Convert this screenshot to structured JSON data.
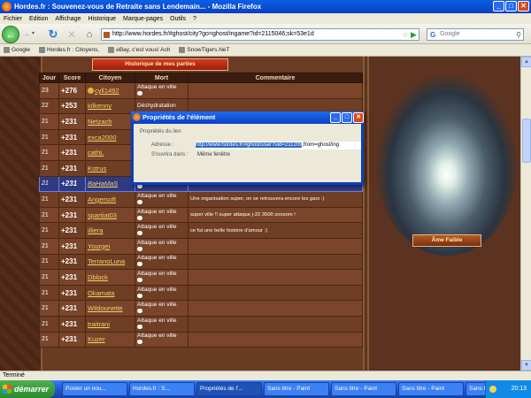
{
  "window": {
    "title": "Hordes.fr : Souvenez-vous de Retraite sans Lendemain... - Mozilla Firefox",
    "min": "_",
    "max": "□",
    "close": "✕"
  },
  "menu": [
    "Fichier",
    "Edition",
    "Affichage",
    "Historique",
    "Marque-pages",
    "Outils",
    "?"
  ],
  "nav": {
    "url": "http://www.hordes.fr/#ghost/city?go=ghost/ingame?id=2115046;sk=53e1d",
    "search_placeholder": "Google",
    "icons": [
      "back-arrow-icon",
      "forward-arrow-icon",
      "reload-icon",
      "stop-icon",
      "home-icon",
      "star-icon",
      "go-icon",
      "magnifier-icon"
    ]
  },
  "bookmarks": [
    "Google",
    "Hordes.fr : Citoyens,",
    "eBay, c'est vous! Ach",
    "SnowTigers.NeT"
  ],
  "page": {
    "history_title": "Historique de mes parties",
    "columns": [
      "Jour",
      "Score",
      "Citoyen",
      "Mort",
      "Commentaire"
    ],
    "rows": [
      {
        "day": "23",
        "score": "+276",
        "citizen": "cyll1492",
        "death": "Attaque en ville",
        "comment": ""
      },
      {
        "day": "22",
        "score": "+253",
        "citizen": "kilkenny",
        "death": "Déshydratation",
        "comment": ""
      },
      {
        "day": "21",
        "score": "+231",
        "citizen": "Netzach",
        "death": "",
        "comment": ""
      },
      {
        "day": "21",
        "score": "+231",
        "citizen": "exca2000",
        "death": "",
        "comment": ""
      },
      {
        "day": "21",
        "score": "+231",
        "citizen": "cathL",
        "death": "",
        "comment": ""
      },
      {
        "day": "21",
        "score": "+231",
        "citizen": "Kstrus",
        "death": "",
        "comment": ""
      },
      {
        "day": "21",
        "score": "+231",
        "citizen": "BaHaMaS",
        "death": "Attaque en ville",
        "comment": "",
        "highlight": true
      },
      {
        "day": "21",
        "score": "+231",
        "citizen": "Angersoft",
        "death": "Attaque en ville",
        "comment": "Une organisation super, on se retrouvera encore les gars :)"
      },
      {
        "day": "21",
        "score": "+231",
        "citizen": "spartiat03",
        "death": "Attaque en ville",
        "comment": "super ville !! super attaque j-22 3500 zoozom !"
      },
      {
        "day": "21",
        "score": "+231",
        "citizen": "illiera",
        "death": "Attaque en ville",
        "comment": "ce fut une belle histoire d'amour :)"
      },
      {
        "day": "21",
        "score": "+231",
        "citizen": "Yourgei",
        "death": "Attaque en ville",
        "comment": ""
      },
      {
        "day": "21",
        "score": "+231",
        "citizen": "TerranoLuna",
        "death": "Attaque en ville",
        "comment": ""
      },
      {
        "day": "21",
        "score": "+231",
        "citizen": "Dblock",
        "death": "Attaque en ville",
        "comment": ""
      },
      {
        "day": "21",
        "score": "+231",
        "citizen": "Okamata",
        "death": "Attaque en ville",
        "comment": ""
      },
      {
        "day": "21",
        "score": "+231",
        "citizen": "Wildounette",
        "death": "Attaque en ville",
        "comment": ""
      },
      {
        "day": "21",
        "score": "+231",
        "citizen": "traitrani",
        "death": "Attaque en ville",
        "comment": ""
      },
      {
        "day": "21",
        "score": "+231",
        "citizen": "Kuzer",
        "death": "Attaque en ville",
        "comment": ""
      }
    ],
    "soul_label": "Âme Faible"
  },
  "dialog": {
    "title": "Propriétés de l'élément",
    "section": "Propriétés du lien",
    "address_label": "Adresse :",
    "address_selected": "http://www.hordes.fr/#ghost/user?uid=211209",
    "address_rest": ";from=ghost/ing",
    "open_label": "S'ouvrira dans :",
    "open_value": "Même fenêtre"
  },
  "status": "Terminé",
  "taskbar": {
    "start": "démarrer",
    "tasks": [
      "Poster un nou...",
      "Hordes.fr : S...",
      "Propriétés de l'...",
      "Sans titre - Paint",
      "Sans titre - Paint",
      "Sans titre - Paint",
      "Sans titre - Paint"
    ],
    "active_task": 2,
    "clock": "20:13"
  }
}
